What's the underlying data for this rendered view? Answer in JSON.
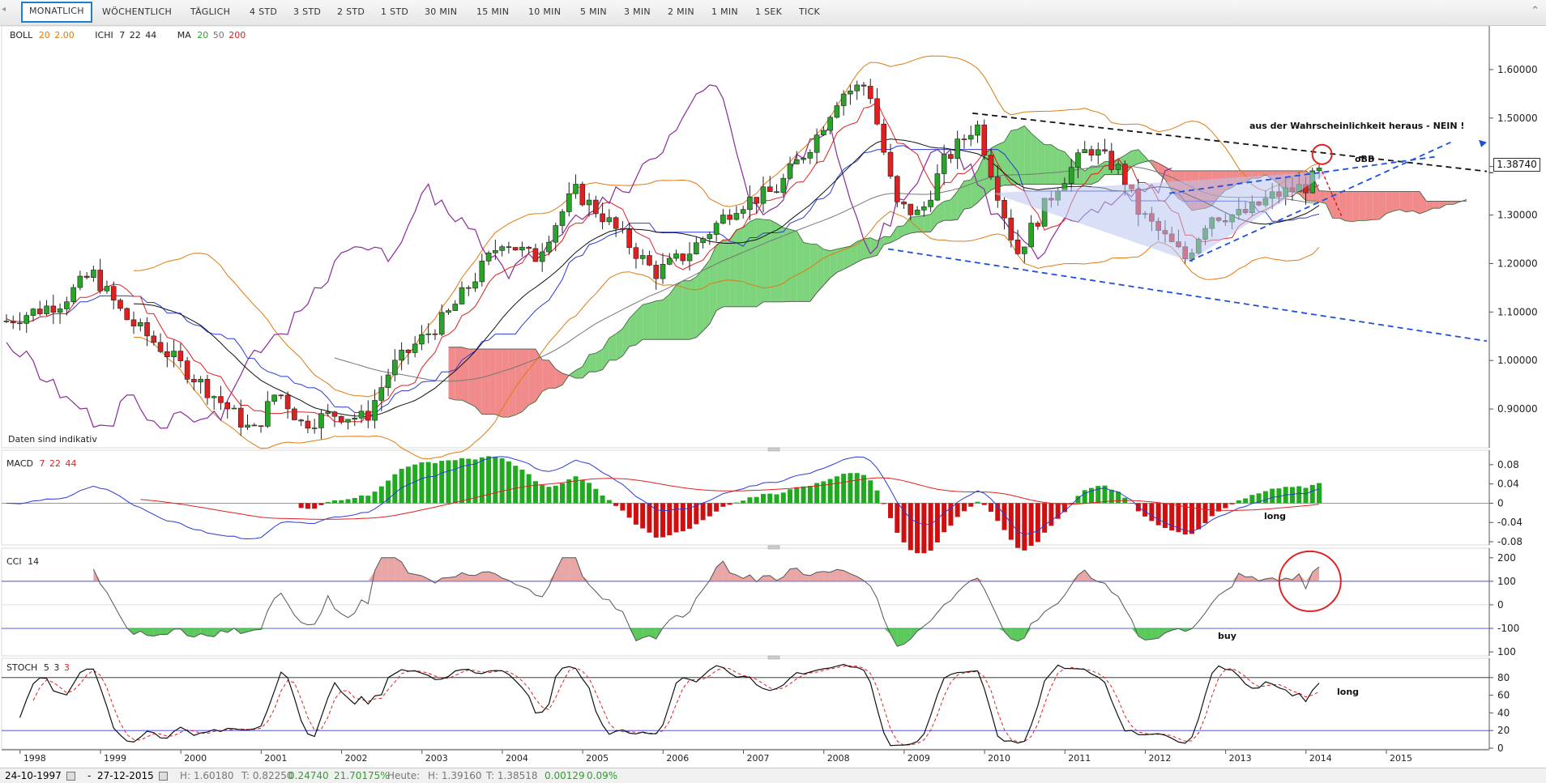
{
  "toolbar": {
    "timeframes": [
      "MONATLICH",
      "WÖCHENTLICH",
      "TÄGLICH",
      "4 STD",
      "3 STD",
      "2 STD",
      "1 STD",
      "30 MIN",
      "15 MIN",
      "10 MIN",
      "5 MIN",
      "3 MIN",
      "2 MIN",
      "1 MIN",
      "1 SEK",
      "TICK"
    ],
    "active": "MONATLICH"
  },
  "indicators": {
    "boll": {
      "name": "BOLL",
      "p1": "20",
      "p2": "2.00"
    },
    "ichi": {
      "name": "ICHI",
      "p1": "7",
      "p2": "22",
      "p3": "44"
    },
    "ma": {
      "name": "MA",
      "p1": "20",
      "p2": "50",
      "p3": "200"
    },
    "macd": {
      "name": "MACD",
      "p1": "7",
      "p2": "22",
      "p3": "44"
    },
    "cci": {
      "name": "CCI",
      "p1": "14"
    },
    "stoch": {
      "name": "STOCH",
      "p1": "5",
      "p2": "3",
      "p3": "3"
    }
  },
  "notes": {
    "disclaimer": "Daten sind indikativ",
    "main_annotation": "aus der Wahrscheinlichkeit heraus - NEIN !",
    "bb_label": "oBB",
    "macd_label": "long",
    "cci_label": "buy",
    "stoch_label": "long"
  },
  "price": {
    "current": "1.38740"
  },
  "colors": {
    "up": "#29a329",
    "down": "#e02020",
    "accent": "#1d7fd1",
    "kumo_bull": "#66cc66",
    "kumo_bear": "#ee7777"
  },
  "chart_data": [
    {
      "type": "candlestick",
      "title": "",
      "x_ticks": [
        "1998",
        "1999",
        "2000",
        "2001",
        "2002",
        "2003",
        "2004",
        "2005",
        "2006",
        "2007",
        "2008",
        "2009",
        "2010",
        "2011",
        "2012",
        "2013",
        "2014",
        "2015"
      ],
      "y_ticks": [
        "1.60000",
        "1.50000",
        "1.40000",
        "1.30000",
        "1.20000",
        "1.10000",
        "1.00000",
        "0.90000"
      ],
      "ylim": [
        0.82,
        1.68
      ],
      "anchors_close": [
        [
          1997.8,
          1.08
        ],
        [
          1998.5,
          1.12
        ],
        [
          1998.9,
          1.18
        ],
        [
          1999.3,
          1.09
        ],
        [
          1999.8,
          1.02
        ],
        [
          2000.4,
          0.93
        ],
        [
          2000.9,
          0.85
        ],
        [
          2001.2,
          0.94
        ],
        [
          2001.5,
          0.87
        ],
        [
          2001.9,
          0.89
        ],
        [
          2002.3,
          0.88
        ],
        [
          2002.6,
          0.98
        ],
        [
          2002.9,
          1.03
        ],
        [
          2003.3,
          1.09
        ],
        [
          2003.7,
          1.18
        ],
        [
          2004.0,
          1.25
        ],
        [
          2004.4,
          1.21
        ],
        [
          2004.9,
          1.35
        ],
        [
          2005.3,
          1.29
        ],
        [
          2005.9,
          1.18
        ],
        [
          2006.3,
          1.22
        ],
        [
          2006.9,
          1.32
        ],
        [
          2007.4,
          1.35
        ],
        [
          2007.9,
          1.46
        ],
        [
          2008.2,
          1.55
        ],
        [
          2008.55,
          1.57
        ],
        [
          2008.9,
          1.32
        ],
        [
          2009.2,
          1.3
        ],
        [
          2009.5,
          1.41
        ],
        [
          2009.9,
          1.49
        ],
        [
          2010.4,
          1.22
        ],
        [
          2010.9,
          1.36
        ],
        [
          2011.3,
          1.44
        ],
        [
          2011.7,
          1.39
        ],
        [
          2011.9,
          1.31
        ],
        [
          2012.5,
          1.21
        ],
        [
          2012.8,
          1.3
        ],
        [
          2013.2,
          1.3
        ],
        [
          2013.6,
          1.34
        ],
        [
          2014.0,
          1.36
        ],
        [
          2014.15,
          1.387
        ]
      ]
    },
    {
      "type": "line",
      "title": "MACD",
      "y_ticks": [
        "0.08",
        "0.04",
        "0",
        "-0.04",
        "-0.08"
      ],
      "ylim": [
        -0.085,
        0.1
      ]
    },
    {
      "type": "line",
      "title": "CCI",
      "y_ticks": [
        "200",
        "100",
        "0",
        "-100",
        "100"
      ],
      "ylim": [
        -210,
        220
      ]
    },
    {
      "type": "line",
      "title": "STOCH",
      "y_ticks": [
        "80",
        "60",
        "40",
        "20",
        "0"
      ],
      "ylim": [
        0,
        100
      ]
    }
  ],
  "status": {
    "from": "24-10-1997",
    "to": "27-12-2015",
    "high": "H: 1.60180",
    "low": "T: 0.82250",
    "change": "0.24740",
    "change_pct": "21.70175%",
    "today_label": "Heute:",
    "today_high": "H: 1.39160",
    "today_low": "T: 1.38518",
    "today_change": "0.00129",
    "today_change_pct": "0.09%"
  }
}
